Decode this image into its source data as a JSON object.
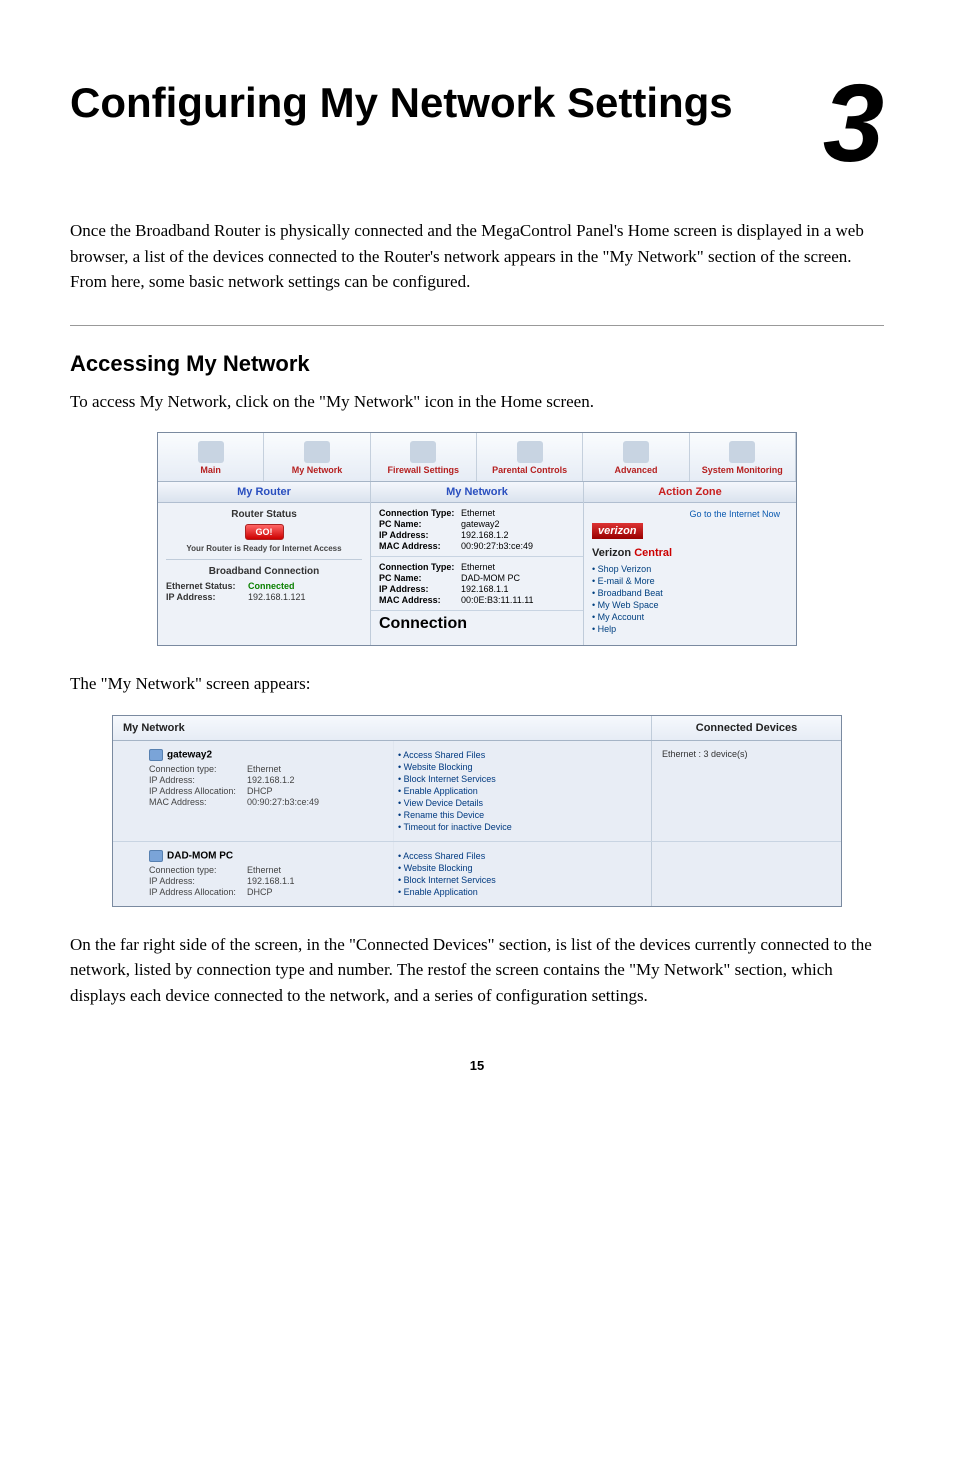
{
  "chapter": {
    "title": "Configuring My Network Settings",
    "number": "3"
  },
  "intro": "Once the Broadband Router is physically connected and the MegaControl Panel's Home screen is displayed in a web browser, a list of the devices connected to the Router's network appears in the \"My Network\" section of the screen. From here, some basic network settings can be configured.",
  "section_heading": "Accessing My Network",
  "para1": "To access My Network, click on the \"My Network\" icon in the Home screen.",
  "para2": "The \"My Network\" screen appears:",
  "para3": "On the far right side of the screen, in the \"Connected Devices\" section, is list of the devices currently connected to the network, listed by connection type and number. The restof the screen contains the \"My Network\" section, which displays each device connected to the network, and a series of configuration settings.",
  "page_number": "15",
  "ss1": {
    "tabs": [
      "Main",
      "My Network",
      "Firewall Settings",
      "Parental Controls",
      "Advanced",
      "System Monitoring"
    ],
    "col_headers": [
      "My Router",
      "My Network",
      "Action Zone"
    ],
    "router_status_label": "Router Status",
    "go_label": "GO!",
    "ready_label": "Your Router is Ready for Internet Access",
    "bb_title": "Broadband Connection",
    "eth_status_k": "Ethernet Status:",
    "eth_status_v": "Connected",
    "ip_k": "IP Address:",
    "ip_v": "192.168.1.121",
    "conn1": {
      "type_k": "Connection Type:",
      "type_v": "Ethernet",
      "pcname_k": "PC Name:",
      "pcname_v": "gateway2",
      "ipk": "IP Address:",
      "ipv": "192.168.1.2",
      "mack": "MAC Address:",
      "macv": "00:90:27:b3:ce:49"
    },
    "conn2": {
      "type_k": "Connection Type:",
      "type_v": "Ethernet",
      "pcname_k": "PC Name:",
      "pcname_v": "DAD-MOM PC",
      "ipk": "IP Address:",
      "ipv": "192.168.1.1",
      "mack": "MAC Address:",
      "macv": "00:0E:B3:11.11.11"
    },
    "connection_label": "Connection",
    "goto_label": "Go to the Internet Now",
    "verizon": "verizon",
    "vcentral1": "Verizon",
    "vcentral2": "Central",
    "links": [
      "Shop Verizon",
      "E-mail & More",
      "Broadband Beat",
      "My Web Space",
      "My Account",
      "Help"
    ]
  },
  "ss2": {
    "title": "My Network",
    "connected_title": "Connected Devices",
    "connected_line": "Ethernet :   3 device(s)",
    "dev1": {
      "name": "gateway2",
      "ct_k": "Connection type:",
      "ct_v": "Ethernet",
      "ip_k": "IP Address:",
      "ip_v": "192.168.1.2",
      "alloc_k": "IP Address Allocation:",
      "alloc_v": "DHCP",
      "mac_k": "MAC Address:",
      "mac_v": "00:90:27:b3:ce:49",
      "actions": [
        "Access Shared Files",
        "Website Blocking",
        "Block Internet Services",
        "Enable Application",
        "View Device Details",
        "Rename this Device",
        "Timeout for inactive Device"
      ]
    },
    "dev2": {
      "name": "DAD-MOM PC",
      "ct_k": "Connection type:",
      "ct_v": "Ethernet",
      "ip_k": "IP Address:",
      "ip_v": "192.168.1.1",
      "alloc_k": "IP Address Allocation:",
      "alloc_v": "DHCP",
      "actions": [
        "Access Shared Files",
        "Website Blocking",
        "Block Internet Services",
        "Enable Application"
      ]
    }
  }
}
